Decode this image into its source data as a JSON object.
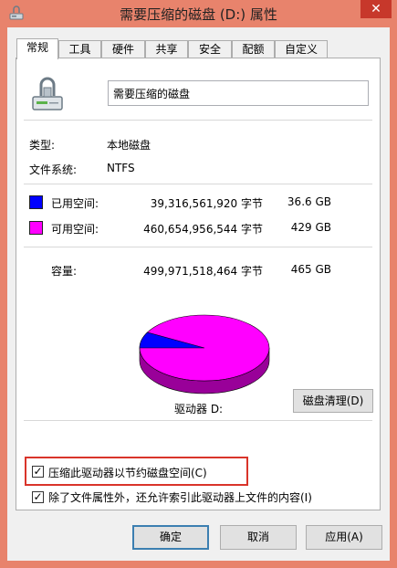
{
  "window": {
    "title": "需要压缩的磁盘 (D:) 属性",
    "close_label": "✕"
  },
  "tabs": [
    {
      "label": "常规",
      "active": true
    },
    {
      "label": "工具"
    },
    {
      "label": "硬件"
    },
    {
      "label": "共享"
    },
    {
      "label": "安全"
    },
    {
      "label": "配额"
    },
    {
      "label": "自定义"
    }
  ],
  "general": {
    "volume_name": "需要压缩的磁盘",
    "type_label": "类型:",
    "type_value": "本地磁盘",
    "fs_label": "文件系统:",
    "fs_value": "NTFS",
    "used": {
      "label": "已用空间:",
      "bytes": "39,316,561,920 字节",
      "size": "36.6 GB",
      "color": "#0000ff"
    },
    "free": {
      "label": "可用空间:",
      "bytes": "460,654,956,544 字节",
      "size": "429 GB",
      "color": "#ff00ff"
    },
    "capacity": {
      "label": "容量:",
      "bytes": "499,971,518,464 字节",
      "size": "465 GB"
    },
    "used_fraction": 0.0786,
    "drive_label": "驱动器 D:",
    "cleanup_button": "磁盘清理(D)",
    "compress_checkbox": {
      "label": "压缩此驱动器以节约磁盘空间(C)",
      "checked": true
    },
    "index_checkbox": {
      "label": "除了文件属性外，还允许索引此驱动器上文件的内容(I)",
      "checked": true
    }
  },
  "buttons": {
    "ok": "确定",
    "cancel": "取消",
    "apply": "应用(A)"
  },
  "colors": {
    "titlebar": "#e8836c",
    "highlight_box": "#d9342a"
  }
}
